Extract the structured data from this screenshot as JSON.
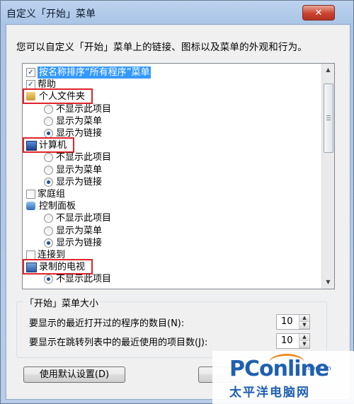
{
  "window": {
    "title": "自定义「开始」菜单",
    "close_glyph": "✕"
  },
  "intro_text": "您可以自定义「开始」菜单上的链接、图标以及菜单的外观和行为。",
  "tree": [
    {
      "kind": "checkbox",
      "checked": true,
      "label": "按名称排序“所有程序”菜单",
      "selected": true
    },
    {
      "kind": "checkbox",
      "checked": true,
      "label": "帮助"
    },
    {
      "kind": "header",
      "icon": "user-folder-icon",
      "label": "个人文件夹",
      "highlight": true
    },
    {
      "kind": "radio",
      "checked": false,
      "label": "不显示此项目"
    },
    {
      "kind": "radio",
      "checked": false,
      "label": "显示为菜单"
    },
    {
      "kind": "radio",
      "checked": true,
      "label": "显示为链接"
    },
    {
      "kind": "header",
      "icon": "computer-icon",
      "label": "计算机",
      "highlight": true
    },
    {
      "kind": "radio",
      "checked": false,
      "label": "不显示此项目"
    },
    {
      "kind": "radio",
      "checked": false,
      "label": "显示为菜单"
    },
    {
      "kind": "radio",
      "checked": true,
      "label": "显示为链接"
    },
    {
      "kind": "checkbox",
      "checked": false,
      "label": "家庭组"
    },
    {
      "kind": "header",
      "icon": "control-panel-icon",
      "label": "控制面板"
    },
    {
      "kind": "radio",
      "checked": false,
      "label": "不显示此项目"
    },
    {
      "kind": "radio",
      "checked": false,
      "label": "显示为菜单"
    },
    {
      "kind": "radio",
      "checked": true,
      "label": "显示为链接"
    },
    {
      "kind": "checkbox",
      "checked": false,
      "label": "连接到"
    },
    {
      "kind": "header",
      "icon": "recorded-tv-icon",
      "label": "录制的电视",
      "highlight": true
    },
    {
      "kind": "radio",
      "checked": true,
      "label": "不显示此项目"
    }
  ],
  "size_group": {
    "title": "「开始」菜单大小",
    "recent_programs_label": "要显示的最近打开过的程序的数目(N):",
    "recent_programs_value": "10",
    "jump_list_label": "要显示在跳转列表中的最近使用的项目数(J):",
    "jump_list_value": "10"
  },
  "buttons": {
    "defaults": "使用默认设置(D)"
  },
  "watermark": {
    "logo": "PConline",
    "domain": ".com.cn",
    "name": "太平洋电脑网"
  }
}
